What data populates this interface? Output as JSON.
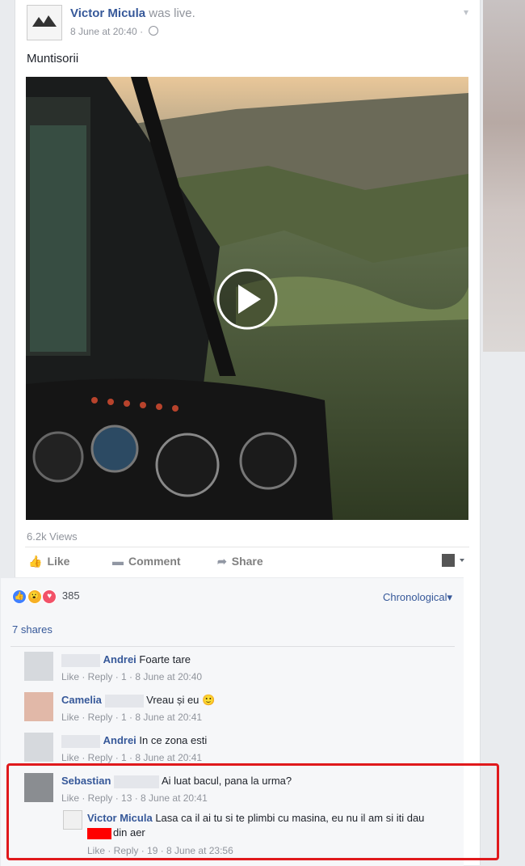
{
  "post": {
    "author": "Victor Micula",
    "status": "was live.",
    "timestamp": "8 June at 20:40 ·",
    "caption": "Muntisorii",
    "views": "6.2k Views"
  },
  "actions": {
    "like": "Like",
    "comment": "Comment",
    "share": "Share"
  },
  "reactions": {
    "count": "385",
    "sort": "Chronological"
  },
  "shares": "7 shares",
  "comments": [
    {
      "name": "Andrei",
      "text": "Foarte tare",
      "footer": "Like · Reply · 1 · 8 June at 20:40"
    },
    {
      "name": "Camelia",
      "text": "Vreau și eu 🙂",
      "footer": "Like · Reply · 1 · 8 June at 20:41"
    },
    {
      "name": "Andrei",
      "text": "In ce zona esti",
      "footer": "Like · Reply · 1 · 8 June at 20:41"
    },
    {
      "name": "Sebastian",
      "text": "Ai luat bacul, pana la urma?",
      "footer": "Like · Reply · 13 · 8 June at 20:41"
    }
  ],
  "reply": {
    "name": "Victor Micula",
    "text_line1": "Lasa ca il ai tu si te plimbi cu masina, eu nu il am si iti dau",
    "text_line2": "din aer",
    "footer": "Like · Reply · 19 · 8 June at 23:56"
  },
  "icons": {
    "play": "play-icon",
    "like": "thumbs-up-icon",
    "comment": "comment-icon",
    "share": "share-arrow-icon"
  },
  "colors": {
    "link": "#365899",
    "highlight": "#e0191c"
  }
}
